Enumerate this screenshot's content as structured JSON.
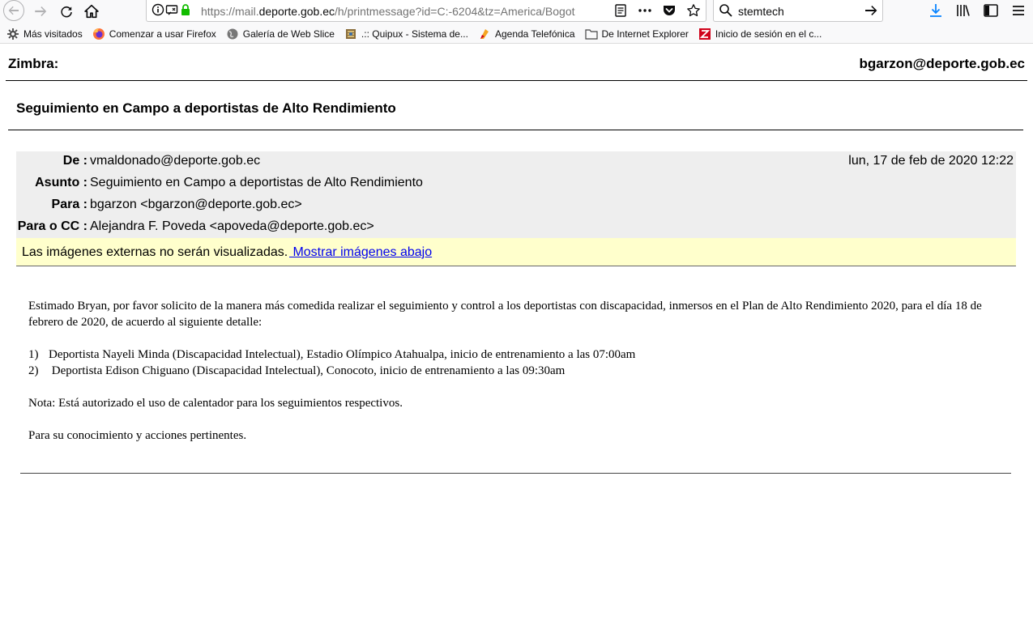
{
  "browser": {
    "url_prefix": "https://mail.",
    "url_domain": "deporte.gob.ec",
    "url_suffix": "/h/printmessage?id=C:-6204&tz=America/Bogot",
    "search_value": "stemtech",
    "icons": {
      "back": "back-arrow-icon",
      "forward": "forward-arrow-icon",
      "reload": "reload-icon",
      "home": "home-icon",
      "info": "info-icon",
      "permissions": "permissions-icon",
      "lock": "lock-icon",
      "reader": "reader-view-icon",
      "more": "more-actions-icon",
      "pocket": "pocket-icon",
      "bookmark": "bookmark-star-icon",
      "search": "search-icon",
      "search_go": "search-go-icon",
      "downloads": "download-icon",
      "library": "library-icon",
      "sidebar": "sidebar-icon",
      "menu": "hamburger-menu-icon"
    }
  },
  "bookmarks": [
    {
      "label": "Más visitados",
      "icon": "gear-icon"
    },
    {
      "label": "Comenzar a usar Firefox",
      "icon": "firefox-icon"
    },
    {
      "label": "Galería de Web Slice",
      "icon": "globe-icon"
    },
    {
      "label": ".:: Quipux - Sistema de...",
      "icon": "quipux-icon"
    },
    {
      "label": "Agenda Telefónica",
      "icon": "agenda-icon"
    },
    {
      "label": "De Internet Explorer",
      "icon": "folder-icon"
    },
    {
      "label": "Inicio de sesión en el c...",
      "icon": "zimbra-icon"
    }
  ],
  "print": {
    "app_label": "Zimbra:",
    "account": "bgarzon@deporte.gob.ec",
    "subject_title": "Seguimiento en Campo a deportistas de Alto Rendimiento"
  },
  "header": {
    "from_label": "De :",
    "from_value": "vmaldonado@deporte.gob.ec",
    "date": "lun, 17 de feb de 2020 12:22",
    "subject_label": "Asunto :",
    "subject_value": "Seguimiento en Campo a deportistas de Alto Rendimiento",
    "to_label": "Para :",
    "to_value": "bgarzon <bgarzon@deporte.gob.ec>",
    "cc_label": "Para o CC :",
    "cc_value": "Alejandra F. Poveda <apoveda@deporte.gob.ec>"
  },
  "images_notice": {
    "message": "Las imágenes externas no serán visualizadas.",
    "link": " Mostrar imágenes abajo"
  },
  "body": {
    "intro": "Estimado Bryan, por favor solicito de la manera más comedida realizar el seguimiento y control a los deportistas con discapacidad, inmersos en el Plan de Alto Rendimiento 2020, para el día 18 de febrero de 2020, de acuerdo al siguiente detalle:",
    "items": [
      {
        "num": "1)",
        "text": "Deportista Nayeli Minda (Discapacidad Intelectual), Estadio Olímpico Atahualpa, inicio de entrenamiento a las 07:00am"
      },
      {
        "num": "2)",
        "text": " Deportista Edison Chiguano (Discapacidad Intelectual), Conocoto, inicio de entrenamiento a las 09:30am"
      }
    ],
    "note": "Nota: Está autorizado el uso de calentador para los seguimientos respectivos.",
    "closing": "Para su conocimiento y acciones pertinentes."
  }
}
